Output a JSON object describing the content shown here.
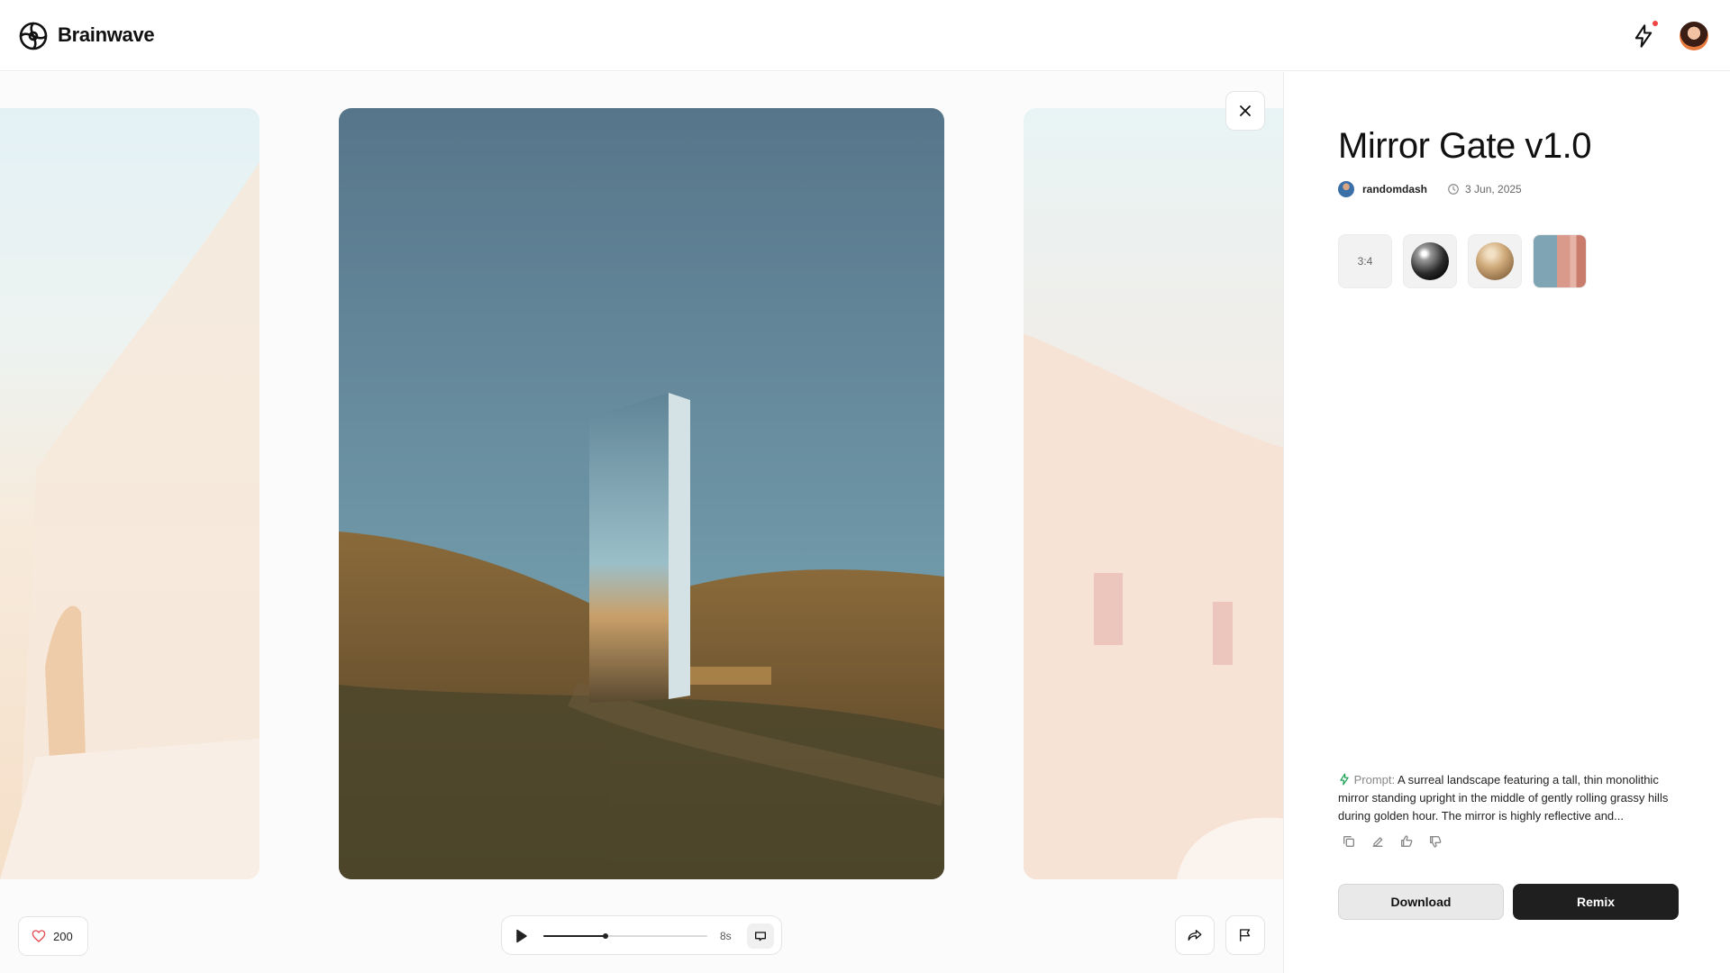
{
  "header": {
    "brand": "Brainwave",
    "notification_dot": true
  },
  "viewer": {
    "likes": "200",
    "player": {
      "duration": "8s",
      "progress_fraction": 0.38
    }
  },
  "panel": {
    "title": "Mirror Gate v1.0",
    "author": "randomdash",
    "date": "3 Jun, 2025",
    "chips": [
      {
        "type": "aspect-ratio",
        "label": "3:4"
      },
      {
        "type": "style",
        "icon": "chrome-sphere"
      },
      {
        "type": "style",
        "icon": "sand-sphere"
      },
      {
        "type": "reference",
        "icon": "reference-image"
      }
    ],
    "prompt_label": "Prompt:",
    "prompt_text": "A surreal landscape featuring a tall, thin monolithic mirror standing upright in the middle of gently rolling grassy hills during golden hour. The mirror is highly reflective and...",
    "download_label": "Download",
    "remix_label": "Remix"
  },
  "colors": {
    "accent_green": "#22a55a",
    "notification": "#ef4444",
    "remix_bg": "#1f1f1f"
  }
}
